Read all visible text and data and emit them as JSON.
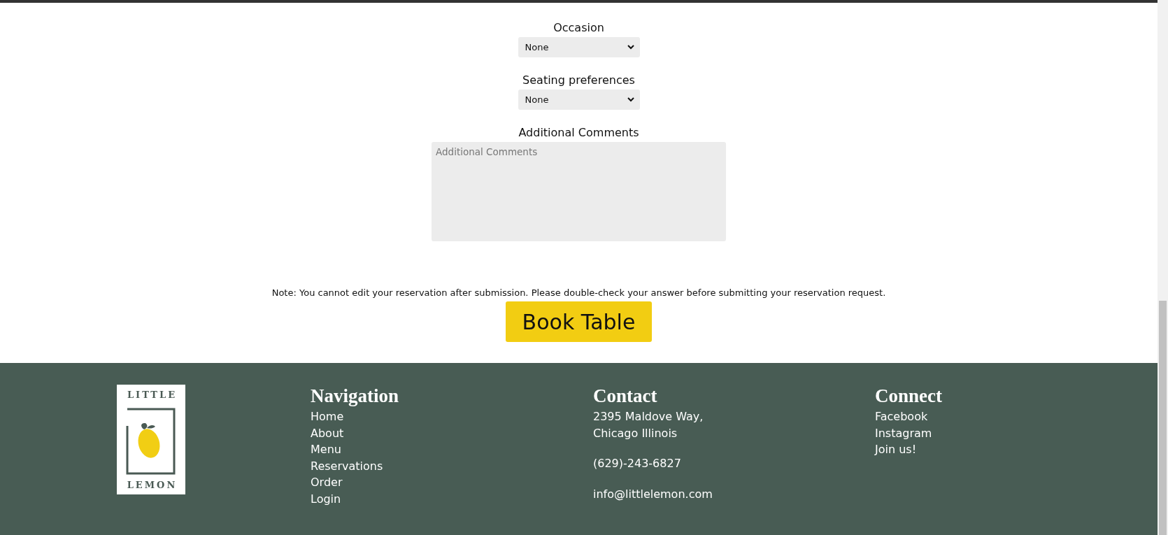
{
  "form": {
    "fields": [
      {
        "kind": "select",
        "label": "Occasion",
        "value": "None"
      },
      {
        "kind": "select",
        "label": "Seating preferences",
        "value": "None"
      },
      {
        "kind": "textarea",
        "label": "Additional Comments",
        "placeholder": "Additional Comments"
      }
    ],
    "note": "Note: You cannot edit your reservation after submission. Please double-check your answer before submitting your reservation request.",
    "submit_button": "Book Table"
  },
  "footer": {
    "logo": {
      "top": "LITTLE",
      "bottom": "LEMON"
    },
    "columns": [
      {
        "heading": "Navigation",
        "kind": "links",
        "items": [
          "Home",
          "About",
          "Menu",
          "Reservations",
          "Order",
          "Login"
        ]
      },
      {
        "heading": "Contact",
        "kind": "contact",
        "items": [
          [
            "2395 Maldove Way,",
            "Chicago Illinois"
          ],
          [
            "(629)-243-6827"
          ],
          [
            "info@littlelemon.com"
          ]
        ]
      },
      {
        "heading": "Connect",
        "kind": "links",
        "items": [
          "Facebook",
          "Instagram",
          "Join us!"
        ]
      }
    ]
  }
}
